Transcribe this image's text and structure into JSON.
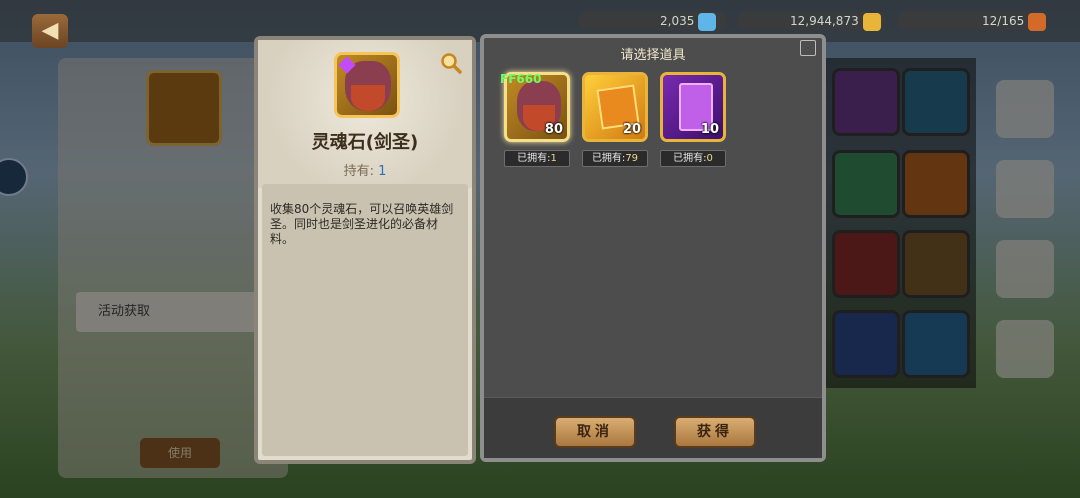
{
  "topbar": {
    "gems": "2,035",
    "gold": "12,944,873",
    "stamina": "12/165"
  },
  "item": {
    "name": "灵魂石(剑圣)",
    "hold_label": "持有:",
    "hold_value": "1",
    "description": "收集80个灵魂石，可以召唤英雄剑圣。同时也是剑圣进化的必备材料。"
  },
  "select_panel": {
    "title": "请选择道具",
    "overlay_tag": "FF660",
    "options": [
      {
        "name": "soul-stone-blademaster",
        "count": "80",
        "owned_label": "已拥有:",
        "owned": "1"
      },
      {
        "name": "orange-chest",
        "count": "20",
        "owned_label": "已拥有:",
        "owned": "79"
      },
      {
        "name": "purple-card-pack",
        "count": "10",
        "owned_label": "已拥有:",
        "owned": "0"
      }
    ],
    "cancel": "取消",
    "obtain": "获得"
  },
  "background": {
    "side_labels": [
      "活动获取",
      "使用"
    ]
  },
  "colors": {
    "panel_bg": "#e2dccc",
    "select_bg": "#4d4d4d",
    "accent_gold": "#f4e08a",
    "hold_blue": "#2f6fb5",
    "button_gold": "#c99a5e"
  }
}
